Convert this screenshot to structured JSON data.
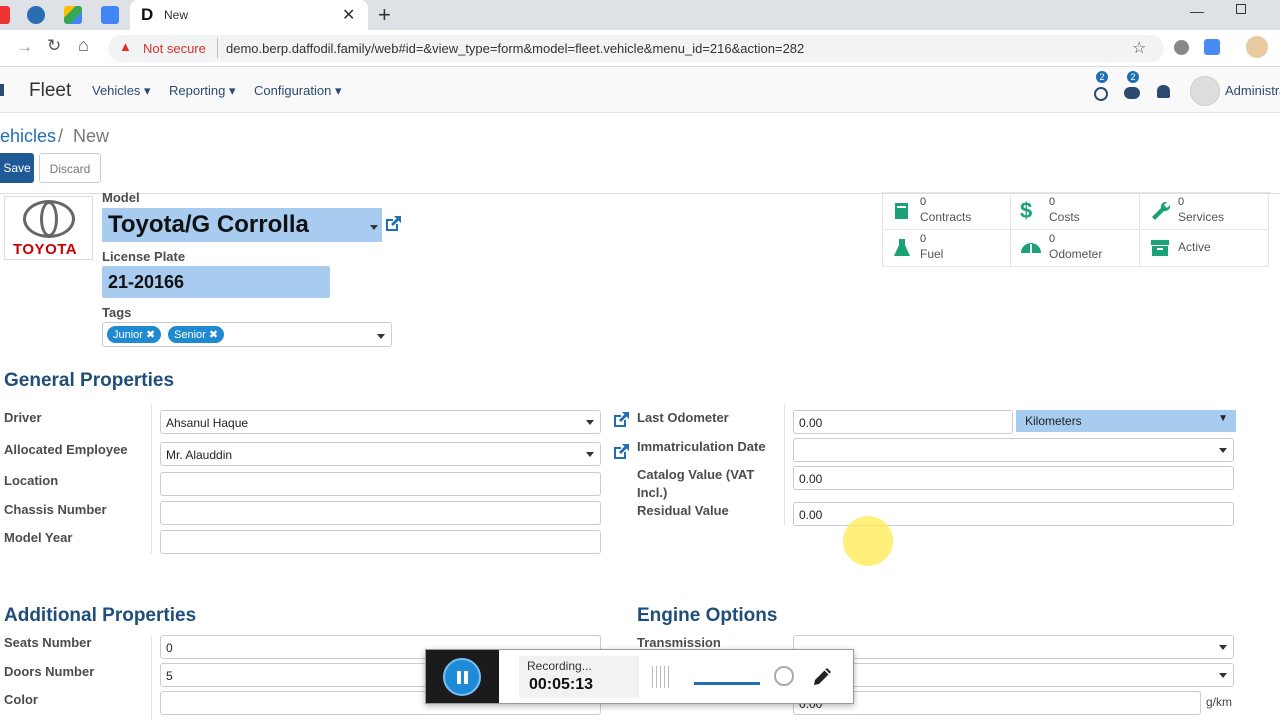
{
  "browser": {
    "tab_title": "New",
    "tab_favicon_letter": "D",
    "not_secure": "Not secure",
    "url": "demo.berp.daffodil.family/web#id=&view_type=form&model=fleet.vehicle&menu_id=216&action=282"
  },
  "nav": {
    "app_name": "Fleet",
    "menus": [
      "Vehicles",
      "Reporting",
      "Configuration"
    ],
    "activity_count": "2",
    "message_count": "2",
    "user": "Administra"
  },
  "breadcrumb": {
    "parent": "ehicles",
    "sep": "/",
    "current": "New"
  },
  "buttons": {
    "save": "Save",
    "discard": "Discard"
  },
  "header_fields": {
    "model_label": "Model",
    "model_value": "Toyota/G Corrolla",
    "plate_label": "License Plate",
    "plate_value": "21-20166",
    "tags_label": "Tags",
    "tags": [
      "Junior",
      "Senior"
    ],
    "logo_text": "TOYOTA"
  },
  "smart_buttons": [
    {
      "count": "0",
      "label": "Contracts",
      "icon": "book-icon"
    },
    {
      "count": "0",
      "label": "Costs",
      "icon": "dollar-icon"
    },
    {
      "count": "0",
      "label": "Services",
      "icon": "wrench-icon"
    },
    {
      "count": "0",
      "label": "Fuel",
      "icon": "flask-icon"
    },
    {
      "count": "0",
      "label": "Odometer",
      "icon": "tachometer-icon"
    },
    {
      "count": "",
      "label": "Active",
      "icon": "archive-icon"
    }
  ],
  "general": {
    "title": "General Properties",
    "driver_label": "Driver",
    "driver_value": "Ahsanul Haque",
    "employee_label": "Allocated Employee",
    "employee_value": "Mr. Alauddin",
    "location_label": "Location",
    "chassis_label": "Chassis Number",
    "model_year_label": "Model Year",
    "odometer_label": "Last Odometer",
    "odometer_value": "0.00",
    "odometer_unit": "Kilometers",
    "immat_label": "Immatriculation Date",
    "catalog_label_1": "Catalog Value (VAT",
    "catalog_label_2": "Incl.)",
    "catalog_value": "0.00",
    "residual_label": "Residual Value",
    "residual_value": "0.00"
  },
  "additional": {
    "title": "Additional Properties",
    "seats_label": "Seats Number",
    "seats_value": "0",
    "doors_label": "Doors Number",
    "doors_value": "5",
    "color_label": "Color"
  },
  "engine": {
    "title": "Engine Options",
    "transmission_label": "Transmission",
    "co2_value": "0.00",
    "co2_unit": "g/km"
  },
  "recorder": {
    "status": "Recording...",
    "time": "00:05:13"
  }
}
